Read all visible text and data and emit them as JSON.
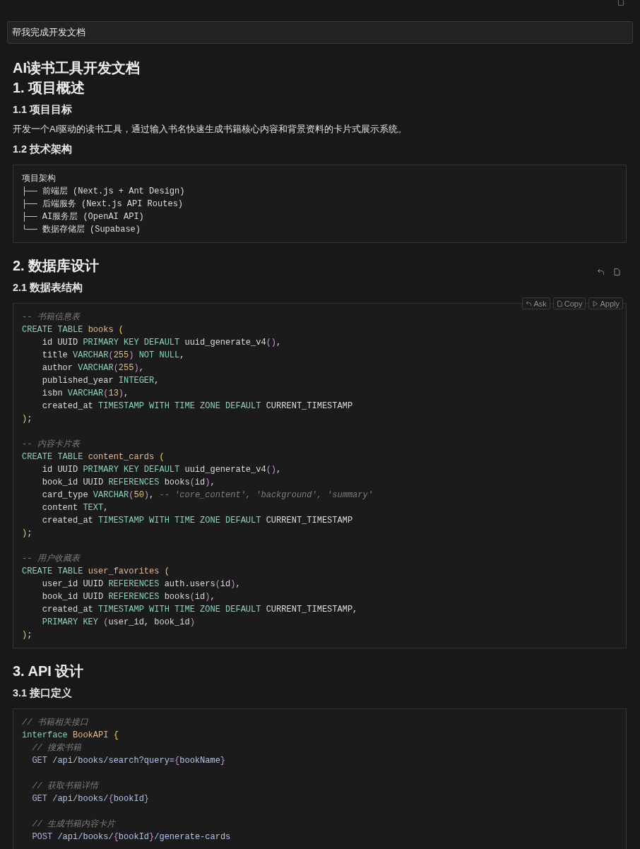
{
  "prompt": {
    "value": "帮我完成开发文档"
  },
  "document": [
    {
      "kind": "title",
      "text": "AI读书工具开发文档"
    },
    {
      "kind": "h2",
      "text": "1. 项目概述"
    },
    {
      "kind": "h3",
      "text": "1.1 项目目标"
    },
    {
      "kind": "p",
      "text": "开发一个AI驱动的读书工具，通过输入书名快速生成书籍核心内容和背景资料的卡片式展示系统。"
    },
    {
      "kind": "h3",
      "text": "1.2 技术架构"
    },
    {
      "kind": "code",
      "lines": [
        {
          "kind": "code",
          "tokens": [
            {
              "kind": "plain",
              "text": "项目架构"
            }
          ]
        },
        {
          "kind": "code",
          "tokens": [
            {
              "kind": "plain",
              "text": "├── 前端层 (Next.js + Ant Design)"
            }
          ]
        },
        {
          "kind": "code",
          "tokens": [
            {
              "kind": "plain",
              "text": "├── 后端服务 (Next.js API Routes)"
            }
          ]
        },
        {
          "kind": "code",
          "tokens": [
            {
              "kind": "plain",
              "text": "├── AI服务层 (OpenAI API)"
            }
          ]
        },
        {
          "kind": "code",
          "tokens": [
            {
              "kind": "plain",
              "text": "└── 数据存储层 (Supabase)"
            }
          ]
        }
      ]
    },
    {
      "kind": "h2",
      "text": "2. 数据库设计"
    },
    {
      "kind": "h3",
      "text": "2.1 数据表结构"
    },
    {
      "kind": "code",
      "buttons": [
        "Ask",
        "Copy",
        "Apply"
      ],
      "lines": [
        {
          "kind": "code",
          "tokens": [
            {
              "kind": "comment",
              "text": "-- 书籍信息表"
            }
          ]
        },
        {
          "kind": "code",
          "tokens": [
            {
              "kind": "kw",
              "text": "CREATE TABLE "
            },
            {
              "kind": "name",
              "text": "books "
            },
            {
              "kind": "paren",
              "text": "("
            }
          ]
        },
        {
          "kind": "code",
          "tokens": [
            {
              "kind": "plain",
              "text": "    id UUID "
            },
            {
              "kind": "kw",
              "text": "PRIMARY KEY DEFAULT "
            },
            {
              "kind": "plain",
              "text": "uuid_generate_v4"
            },
            {
              "kind": "paren2",
              "text": "()"
            },
            {
              "kind": "plain",
              "text": ","
            }
          ]
        },
        {
          "kind": "code",
          "tokens": [
            {
              "kind": "plain",
              "text": "    title "
            },
            {
              "kind": "kw",
              "text": "VARCHAR"
            },
            {
              "kind": "paren2",
              "text": "("
            },
            {
              "kind": "num",
              "text": "255"
            },
            {
              "kind": "paren2",
              "text": ")"
            },
            {
              "kind": "kw",
              "text": " NOT NULL"
            },
            {
              "kind": "plain",
              "text": ","
            }
          ]
        },
        {
          "kind": "code",
          "tokens": [
            {
              "kind": "plain",
              "text": "    author "
            },
            {
              "kind": "kw",
              "text": "VARCHAR"
            },
            {
              "kind": "paren2",
              "text": "("
            },
            {
              "kind": "num",
              "text": "255"
            },
            {
              "kind": "paren2",
              "text": ")"
            },
            {
              "kind": "plain",
              "text": ","
            }
          ]
        },
        {
          "kind": "code",
          "tokens": [
            {
              "kind": "plain",
              "text": "    published_year "
            },
            {
              "kind": "kw",
              "text": "INTEGER"
            },
            {
              "kind": "plain",
              "text": ","
            }
          ]
        },
        {
          "kind": "code",
          "tokens": [
            {
              "kind": "plain",
              "text": "    isbn "
            },
            {
              "kind": "kw",
              "text": "VARCHAR"
            },
            {
              "kind": "paren2",
              "text": "("
            },
            {
              "kind": "num",
              "text": "13"
            },
            {
              "kind": "paren2",
              "text": ")"
            },
            {
              "kind": "plain",
              "text": ","
            }
          ]
        },
        {
          "kind": "code",
          "tokens": [
            {
              "kind": "plain",
              "text": "    created_at "
            },
            {
              "kind": "kw",
              "text": "TIMESTAMP WITH TIME ZONE DEFAULT "
            },
            {
              "kind": "plain",
              "text": "CURRENT_TIMESTAMP"
            }
          ]
        },
        {
          "kind": "code",
          "tokens": [
            {
              "kind": "paren",
              "text": ")"
            },
            {
              "kind": "plain",
              "text": ";"
            }
          ]
        },
        {
          "kind": "blank"
        },
        {
          "kind": "code",
          "tokens": [
            {
              "kind": "comment",
              "text": "-- 内容卡片表"
            }
          ]
        },
        {
          "kind": "code",
          "tokens": [
            {
              "kind": "kw",
              "text": "CREATE TABLE "
            },
            {
              "kind": "name",
              "text": "content_cards "
            },
            {
              "kind": "paren",
              "text": "("
            }
          ]
        },
        {
          "kind": "code",
          "tokens": [
            {
              "kind": "plain",
              "text": "    id UUID "
            },
            {
              "kind": "kw",
              "text": "PRIMARY KEY DEFAULT "
            },
            {
              "kind": "plain",
              "text": "uuid_generate_v4"
            },
            {
              "kind": "paren2",
              "text": "()"
            },
            {
              "kind": "plain",
              "text": ","
            }
          ]
        },
        {
          "kind": "code",
          "tokens": [
            {
              "kind": "plain",
              "text": "    book_id UUID "
            },
            {
              "kind": "kw",
              "text": "REFERENCES "
            },
            {
              "kind": "plain",
              "text": "books"
            },
            {
              "kind": "paren2",
              "text": "("
            },
            {
              "kind": "plain",
              "text": "id"
            },
            {
              "kind": "paren2",
              "text": ")"
            },
            {
              "kind": "plain",
              "text": ","
            }
          ]
        },
        {
          "kind": "code",
          "tokens": [
            {
              "kind": "plain",
              "text": "    card_type "
            },
            {
              "kind": "kw",
              "text": "VARCHAR"
            },
            {
              "kind": "paren2",
              "text": "("
            },
            {
              "kind": "num",
              "text": "50"
            },
            {
              "kind": "paren2",
              "text": ")"
            },
            {
              "kind": "plain",
              "text": ", "
            },
            {
              "kind": "comment",
              "text": "-- 'core_content', 'background', 'summary'"
            }
          ]
        },
        {
          "kind": "code",
          "tokens": [
            {
              "kind": "plain",
              "text": "    content "
            },
            {
              "kind": "kw",
              "text": "TEXT"
            },
            {
              "kind": "plain",
              "text": ","
            }
          ]
        },
        {
          "kind": "code",
          "tokens": [
            {
              "kind": "plain",
              "text": "    created_at "
            },
            {
              "kind": "kw",
              "text": "TIMESTAMP WITH TIME ZONE DEFAULT "
            },
            {
              "kind": "plain",
              "text": "CURRENT_TIMESTAMP"
            }
          ]
        },
        {
          "kind": "code",
          "tokens": [
            {
              "kind": "paren",
              "text": ")"
            },
            {
              "kind": "plain",
              "text": ";"
            }
          ]
        },
        {
          "kind": "blank"
        },
        {
          "kind": "code",
          "tokens": [
            {
              "kind": "comment",
              "text": "-- 用户收藏表"
            }
          ]
        },
        {
          "kind": "code",
          "tokens": [
            {
              "kind": "kw",
              "text": "CREATE TABLE "
            },
            {
              "kind": "name",
              "text": "user_favorites "
            },
            {
              "kind": "paren",
              "text": "("
            }
          ]
        },
        {
          "kind": "code",
          "tokens": [
            {
              "kind": "plain",
              "text": "    user_id UUID "
            },
            {
              "kind": "kw",
              "text": "REFERENCES "
            },
            {
              "kind": "plain",
              "text": "auth.users"
            },
            {
              "kind": "paren2",
              "text": "("
            },
            {
              "kind": "plain",
              "text": "id"
            },
            {
              "kind": "paren2",
              "text": ")"
            },
            {
              "kind": "plain",
              "text": ","
            }
          ]
        },
        {
          "kind": "code",
          "tokens": [
            {
              "kind": "plain",
              "text": "    book_id UUID "
            },
            {
              "kind": "kw",
              "text": "REFERENCES "
            },
            {
              "kind": "plain",
              "text": "books"
            },
            {
              "kind": "paren2",
              "text": "("
            },
            {
              "kind": "plain",
              "text": "id"
            },
            {
              "kind": "paren2",
              "text": ")"
            },
            {
              "kind": "plain",
              "text": ","
            }
          ]
        },
        {
          "kind": "code",
          "tokens": [
            {
              "kind": "plain",
              "text": "    created_at "
            },
            {
              "kind": "kw",
              "text": "TIMESTAMP WITH TIME ZONE DEFAULT "
            },
            {
              "kind": "plain",
              "text": "CURRENT_TIMESTAMP,"
            }
          ]
        },
        {
          "kind": "code",
          "tokens": [
            {
              "kind": "kw",
              "text": "    PRIMARY KEY "
            },
            {
              "kind": "paren2",
              "text": "("
            },
            {
              "kind": "plain",
              "text": "user_id, book_id"
            },
            {
              "kind": "paren2",
              "text": ")"
            }
          ]
        },
        {
          "kind": "code",
          "tokens": [
            {
              "kind": "paren",
              "text": ")"
            },
            {
              "kind": "plain",
              "text": ";"
            }
          ]
        }
      ]
    },
    {
      "kind": "h2",
      "text": "3. API 设计"
    },
    {
      "kind": "h3",
      "text": "3.1 接口定义"
    },
    {
      "kind": "code",
      "lines": [
        {
          "kind": "code",
          "tokens": [
            {
              "kind": "comment",
              "text": "// 书籍相关接口"
            }
          ]
        },
        {
          "kind": "code",
          "tokens": [
            {
              "kind": "kw",
              "text": "interface "
            },
            {
              "kind": "name",
              "text": "BookAPI "
            },
            {
              "kind": "paren",
              "text": "{"
            }
          ]
        },
        {
          "kind": "code",
          "tokens": [
            {
              "kind": "comment",
              "text": "  // 搜索书籍"
            }
          ]
        },
        {
          "kind": "code",
          "tokens": [
            {
              "kind": "verb",
              "text": "  GET "
            },
            {
              "kind": "path",
              "text": "/api/books/search?query="
            },
            {
              "kind": "paren2",
              "text": "{"
            },
            {
              "kind": "path",
              "text": "bookName"
            },
            {
              "kind": "paren2",
              "text": "}"
            }
          ]
        },
        {
          "kind": "blank"
        },
        {
          "kind": "code",
          "tokens": [
            {
              "kind": "comment",
              "text": "  // 获取书籍详情"
            }
          ]
        },
        {
          "kind": "code",
          "tokens": [
            {
              "kind": "verb",
              "text": "  GET "
            },
            {
              "kind": "path",
              "text": "/api/books/"
            },
            {
              "kind": "paren2",
              "text": "{"
            },
            {
              "kind": "path",
              "text": "bookId"
            },
            {
              "kind": "paren2",
              "text": "}"
            }
          ]
        },
        {
          "kind": "blank"
        },
        {
          "kind": "code",
          "tokens": [
            {
              "kind": "comment",
              "text": "  // 生成书籍内容卡片"
            }
          ]
        },
        {
          "kind": "code",
          "tokens": [
            {
              "kind": "verb",
              "text": "  POST "
            },
            {
              "kind": "path",
              "text": "/api/books/"
            },
            {
              "kind": "paren2",
              "text": "{"
            },
            {
              "kind": "path",
              "text": "bookId"
            },
            {
              "kind": "paren2",
              "text": "}"
            },
            {
              "kind": "path",
              "text": "/generate-cards"
            }
          ]
        }
      ]
    }
  ]
}
